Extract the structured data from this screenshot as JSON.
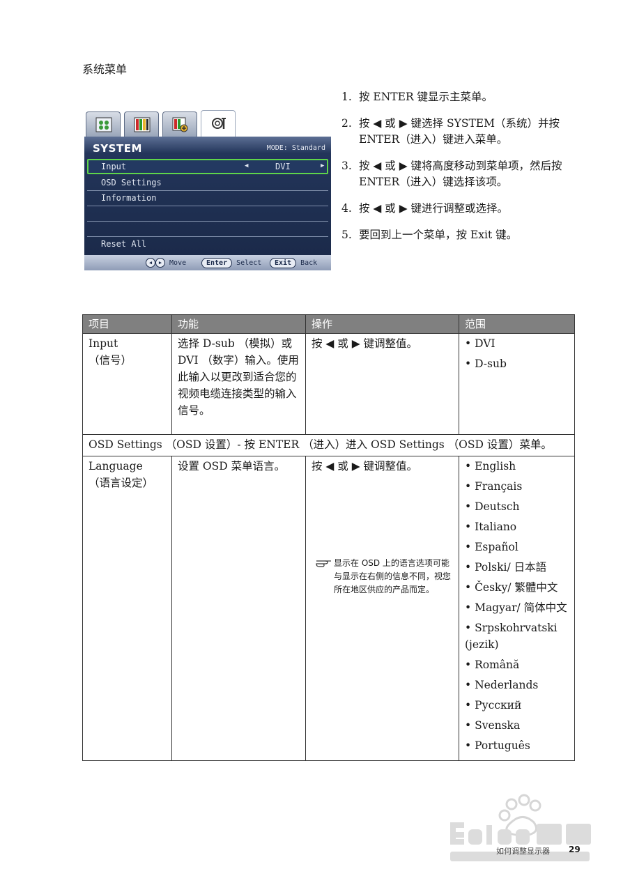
{
  "section_title": "系统菜单",
  "osd": {
    "title": "SYSTEM",
    "mode": "MODE: Standard",
    "rows": [
      {
        "label": "Input",
        "value": "DVI"
      },
      {
        "label": "OSD Settings"
      },
      {
        "label": "Information"
      },
      {
        "label": ""
      },
      {
        "label": ""
      },
      {
        "label": "Reset All"
      }
    ],
    "footer": {
      "move": "Move",
      "enter": "Enter",
      "select": "Select",
      "exit": "Exit",
      "back": "Back"
    },
    "colors": {
      "selected_border": "#5fd54a",
      "panel": "#1b2a4a"
    }
  },
  "steps": [
    {
      "num": "1.",
      "text": "按 ENTER 键显示主菜单。"
    },
    {
      "num": "2.",
      "text": "按 ◀ 或 ▶ 键选择 SYSTEM（系统）并按 ENTER（进入）键进入菜单。"
    },
    {
      "num": "3.",
      "text": "按 ◀ 或 ▶ 键将高度移动到菜单项，然后按 ENTER（进入）键选择该项。"
    },
    {
      "num": "4.",
      "text": "按 ◀ 或 ▶ 键进行调整或选择。"
    },
    {
      "num": "5.",
      "text": "要回到上一个菜单，按 Exit 键。"
    }
  ],
  "table": {
    "headers": [
      "项目",
      "功能",
      "操作",
      "范围"
    ],
    "row1": {
      "item_en": "Input",
      "item_zh": "（信号）",
      "function": "选择 D-sub （模拟）或 DVI （数字）输入。使用此输入以更改到适合您的视频电缆连接类型的输入信号。",
      "operation": "按 ◀ 或 ▶ 键调整值。",
      "range": [
        "• DVI",
        "• D-sub"
      ]
    },
    "span_row": "OSD Settings （OSD 设置）- 按 ENTER （进入）进入 OSD Settings （OSD 设置）菜单。",
    "row2": {
      "item_en": "Language",
      "item_zh": "（语言设定）",
      "function": "设置 OSD 菜单语言。",
      "operation": "按 ◀ 或 ▶ 键调整值。",
      "note": "显示在 OSD 上的语言选项可能与显示在右侧的信息不同，视您所在地区供应的产品而定。",
      "range": [
        "• English",
        "• Français",
        "• Deutsch",
        "• Italiano",
        "• Español",
        "• Polski/ 日本語",
        "• Česky/ 繁體中文",
        "• Magyar/ 简体中文",
        "• Srpskohrvatski (jezik)",
        "• Română",
        "• Nederlands",
        "• Русский",
        "• Svenska",
        "• Português"
      ]
    },
    "header_bg": "#808080"
  },
  "footer": {
    "chapter": "如何调整显示器",
    "page": "29"
  }
}
